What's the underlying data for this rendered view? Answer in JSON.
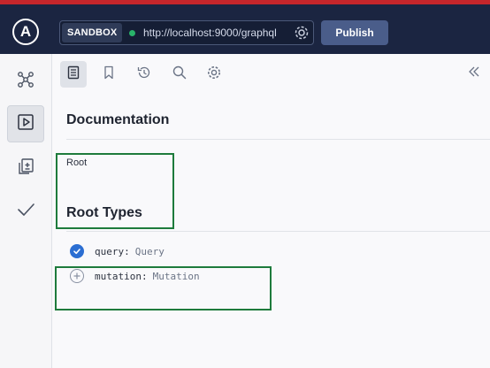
{
  "header": {
    "logo_letter": "A",
    "sandbox_label": "SANDBOX",
    "url": "http://localhost:9000/graphql",
    "publish_label": "Publish"
  },
  "leftnav": {
    "items": [
      {
        "icon": "schema-icon",
        "active": false
      },
      {
        "icon": "play-icon",
        "active": true
      },
      {
        "icon": "diff-icon",
        "active": false
      },
      {
        "icon": "checkmark-icon",
        "active": false
      }
    ]
  },
  "toolbar": {
    "tools": [
      "documentation-icon",
      "bookmark-icon",
      "history-icon",
      "search-icon",
      "gear-icon"
    ],
    "collapse_icon": "double-chevron-left-icon"
  },
  "docs": {
    "title": "Documentation",
    "breadcrumb": "Root",
    "root_types_heading": "Root Types",
    "fields": [
      {
        "name": "query:",
        "type": "Query",
        "selected": true
      },
      {
        "name": "mutation:",
        "type": "Mutation",
        "selected": false
      }
    ]
  },
  "colors": {
    "header_bg": "#1b2541",
    "publish_bg": "#4a5d8a",
    "status_green": "#29b36a",
    "check_blue": "#2b6ed2",
    "highlight_green": "#1e7b3c"
  }
}
